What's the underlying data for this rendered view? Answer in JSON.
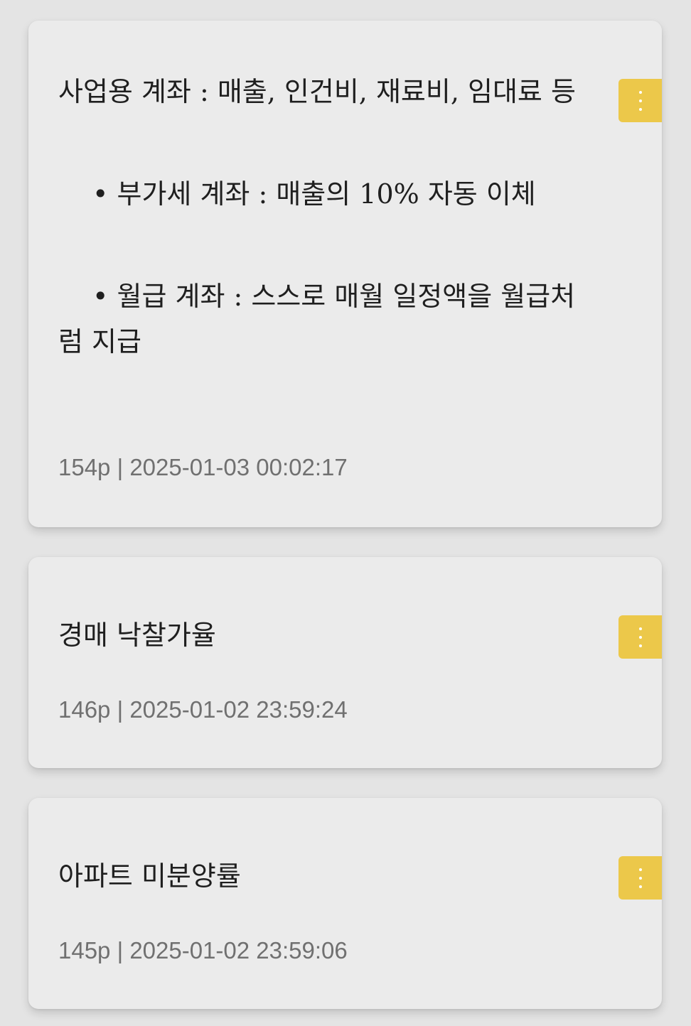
{
  "notes": [
    {
      "lines": [
        "사업용 계좌 : 매출, 인건비, 재료비, 임대료 등",
        "• 부가세 계좌 : 매출의 10% 자동 이체",
        "• 월급 계좌 : 스스로 매월 일정액을 월급처럼 지급"
      ],
      "meta": "154p | 2025-01-03 00:02:17",
      "menu_icon": "more-vertical-icon"
    },
    {
      "lines": [
        "경매 낙찰가율"
      ],
      "meta": "146p | 2025-01-02 23:59:24",
      "menu_icon": "more-vertical-icon"
    },
    {
      "lines": [
        "아파트 미분양률"
      ],
      "meta": "145p | 2025-01-02 23:59:06",
      "menu_icon": "more-vertical-icon"
    }
  ],
  "colors": {
    "background": "#e4e4e4",
    "card": "#ebebeb",
    "menu_button": "#ecc84a",
    "text": "#1f1f1f",
    "meta_text": "#707070"
  }
}
